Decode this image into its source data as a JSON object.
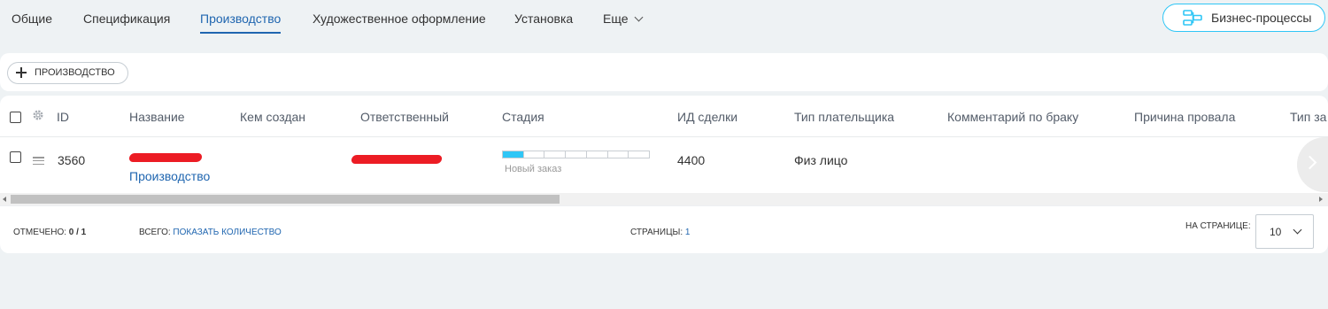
{
  "tabs": [
    {
      "label": "Общие"
    },
    {
      "label": "Спецификация"
    },
    {
      "label": "Производство",
      "active": true
    },
    {
      "label": "Художественное оформление"
    },
    {
      "label": "Установка"
    },
    {
      "label": "Еще"
    }
  ],
  "bp_button": {
    "label": "Бизнес-процессы",
    "icon": "business-process-icon"
  },
  "toolbar": {
    "add_label": "ПРОИЗВОДСТВО"
  },
  "grid": {
    "columns": [
      "ID",
      "Название",
      "Кем создан",
      "Ответственный",
      "Стадия",
      "ИД сделки",
      "Тип плательщика",
      "Комментарий по браку",
      "Причина провала",
      "Тип за"
    ],
    "rows": [
      {
        "id": "3560",
        "name_suffix": "Производство",
        "created_by": "",
        "responsible": "",
        "stage": {
          "label": "Новый заказ",
          "filled_segments": 1,
          "total_segments": 7
        },
        "deal_id": "4400",
        "payer_type": "Физ лицо",
        "defect_comment": "",
        "fail_reason": ""
      }
    ]
  },
  "footer": {
    "selected_label": "ОТМЕЧЕНО:",
    "selected_value": "0 / 1",
    "total_label": "ВСЕГО:",
    "total_link": "ПОКАЗАТЬ КОЛИЧЕСТВО",
    "pages_label": "СТРАНИЦЫ:",
    "pages_value": "1",
    "per_page_label": "НА СТРАНИЦЕ:",
    "per_page_value": "10"
  },
  "colors": {
    "accent": "#2066b0",
    "stage_fill": "#2fc6f6",
    "redaction": "#ec1c24"
  }
}
